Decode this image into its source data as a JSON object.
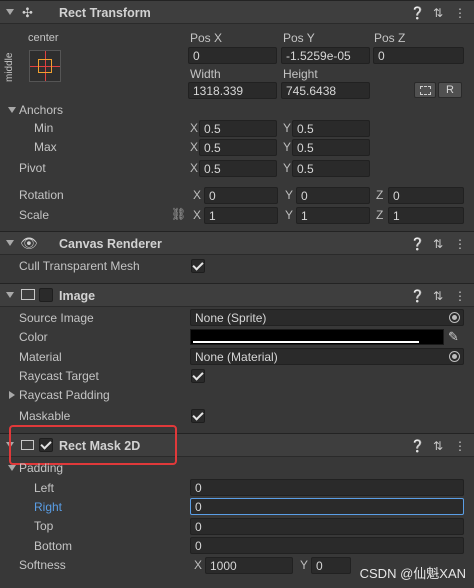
{
  "rect_transform": {
    "title": "Rect Transform",
    "anchor_preset_top": "center",
    "anchor_preset_side": "middle",
    "pos_x_label": "Pos X",
    "pos_y_label": "Pos Y",
    "pos_z_label": "Pos Z",
    "pos_x": "0",
    "pos_y": "-1.5259e-05",
    "pos_z": "0",
    "width_label": "Width",
    "height_label": "Height",
    "width": "1318.339",
    "height": "745.6438",
    "r_button": "R",
    "anchors_label": "Anchors",
    "min_label": "Min",
    "min_x": "0.5",
    "min_y": "0.5",
    "max_label": "Max",
    "max_x": "0.5",
    "max_y": "0.5",
    "pivot_label": "Pivot",
    "pivot_x": "0.5",
    "pivot_y": "0.5",
    "rotation_label": "Rotation",
    "rot_x": "0",
    "rot_y": "0",
    "rot_z": "0",
    "scale_label": "Scale",
    "scale_x": "1",
    "scale_y": "1",
    "scale_z": "1",
    "axis_x": "X",
    "axis_y": "Y",
    "axis_z": "Z"
  },
  "canvas_renderer": {
    "title": "Canvas Renderer",
    "cull_label": "Cull Transparent Mesh",
    "cull_checked": true
  },
  "image": {
    "title": "Image",
    "source_image_label": "Source Image",
    "source_image_value": "None (Sprite)",
    "color_label": "Color",
    "color_value": "#000000",
    "material_label": "Material",
    "material_value": "None (Material)",
    "raycast_target_label": "Raycast Target",
    "raycast_padding_label": "Raycast Padding",
    "maskable_label": "Maskable"
  },
  "rect_mask": {
    "title": "Rect Mask 2D",
    "padding_label": "Padding",
    "left_label": "Left",
    "left_value": "0",
    "right_label": "Right",
    "right_value": "0",
    "top_label": "Top",
    "top_value": "0",
    "bottom_label": "Bottom",
    "bottom_value": "0",
    "softness_label": "Softness",
    "softness_x": "1000",
    "softness_y": "0"
  },
  "header_icons": [
    "help-icon",
    "preset-icon",
    "more-icon"
  ],
  "watermark": "CSDN @仙魁XAN",
  "colors": {
    "highlight": "#e0393a",
    "accent_blue": "#5a9ee6",
    "anchor_orange": "#f0a030",
    "anchor_red": "#e04040"
  }
}
